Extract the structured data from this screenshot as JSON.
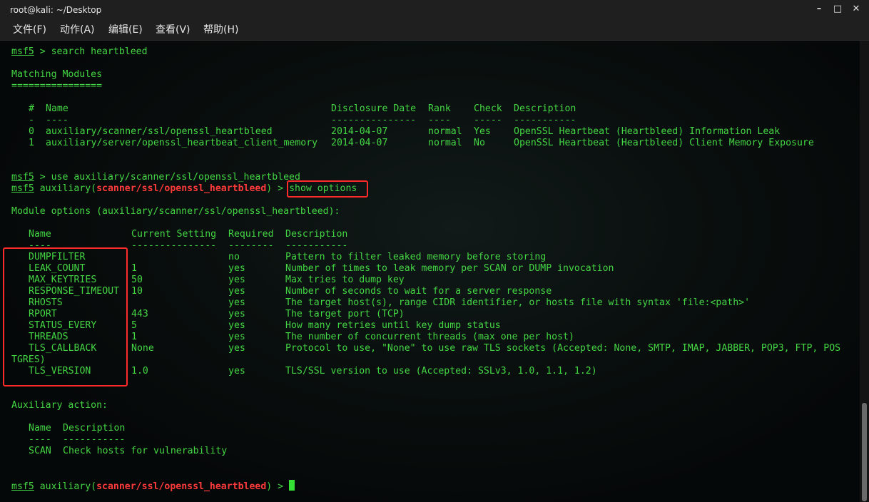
{
  "window": {
    "title": "root@kali: ~/Desktop",
    "buttons": [
      "–",
      "□",
      "✕"
    ]
  },
  "menu": [
    "文件(F)",
    "动作(A)",
    "编辑(E)",
    "查看(V)",
    "帮助(H)"
  ],
  "terminal": {
    "prompt": "msf5",
    "cmd1": " > search heartbleed",
    "matching_title": "Matching Modules",
    "matching_underline": "================",
    "search_table": {
      "headers": [
        "#",
        "Name",
        "Disclosure Date",
        "Rank",
        "Check",
        "Description"
      ],
      "dashes": [
        "-",
        "----",
        "---------------",
        "----",
        "-----",
        "-----------"
      ],
      "rows": [
        [
          "0",
          "auxiliary/scanner/ssl/openssl_heartbleed",
          "2014-04-07",
          "normal",
          "Yes",
          "OpenSSL Heartbeat (Heartbleed) Information Leak"
        ],
        [
          "1",
          "auxiliary/server/openssl_heartbeat_client_memory",
          "2014-04-07",
          "normal",
          "No",
          "OpenSSL Heartbeat (Heartbleed) Client Memory Exposure"
        ]
      ]
    },
    "cmd2": " > use auxiliary/scanner/ssl/openssl_heartbleed",
    "aux_prefix": " auxiliary(",
    "module": "scanner/ssl/openssl_heartbleed",
    "aux_suffix": ") > ",
    "cmd3": "show options",
    "module_options_title": "Module options (auxiliary/scanner/ssl/openssl_heartbleed):",
    "options_table": {
      "headers": [
        "Name",
        "Current Setting",
        "Required",
        "Description"
      ],
      "dashes": [
        "----",
        "---------------",
        "--------",
        "-----------"
      ],
      "rows": [
        [
          "DUMPFILTER",
          "",
          "no",
          "Pattern to filter leaked memory before storing"
        ],
        [
          "LEAK_COUNT",
          "1",
          "yes",
          "Number of times to leak memory per SCAN or DUMP invocation"
        ],
        [
          "MAX_KEYTRIES",
          "50",
          "yes",
          "Max tries to dump key"
        ],
        [
          "RESPONSE_TIMEOUT",
          "10",
          "yes",
          "Number of seconds to wait for a server response"
        ],
        [
          "RHOSTS",
          "",
          "yes",
          "The target host(s), range CIDR identifier, or hosts file with syntax 'file:<path>'"
        ],
        [
          "RPORT",
          "443",
          "yes",
          "The target port (TCP)"
        ],
        [
          "STATUS_EVERY",
          "5",
          "yes",
          "How many retries until key dump status"
        ],
        [
          "THREADS",
          "1",
          "yes",
          "The number of concurrent threads (max one per host)"
        ],
        [
          "TLS_CALLBACK",
          "None",
          "yes",
          "Protocol to use, \"None\" to use raw TLS sockets (Accepted: None, SMTP, IMAP, JABBER, POP3, FTP, POS"
        ],
        [
          "TLS_VERSION",
          "1.0",
          "yes",
          "TLS/SSL version to use (Accepted: SSLv3, 1.0, 1.1, 1.2)"
        ]
      ],
      "wrap": "TGRES)"
    },
    "aux_action_title": "Auxiliary action:",
    "action_table": {
      "headers": [
        "Name",
        "Description"
      ],
      "dashes": [
        "----",
        "-----------"
      ],
      "rows": [
        [
          "SCAN",
          "Check hosts for vulnerability"
        ]
      ]
    }
  },
  "colors": {
    "text": "#44d644",
    "highlight": "#ff2b2b",
    "module": "#ff3a3a",
    "bar": "#1f1f1f"
  }
}
